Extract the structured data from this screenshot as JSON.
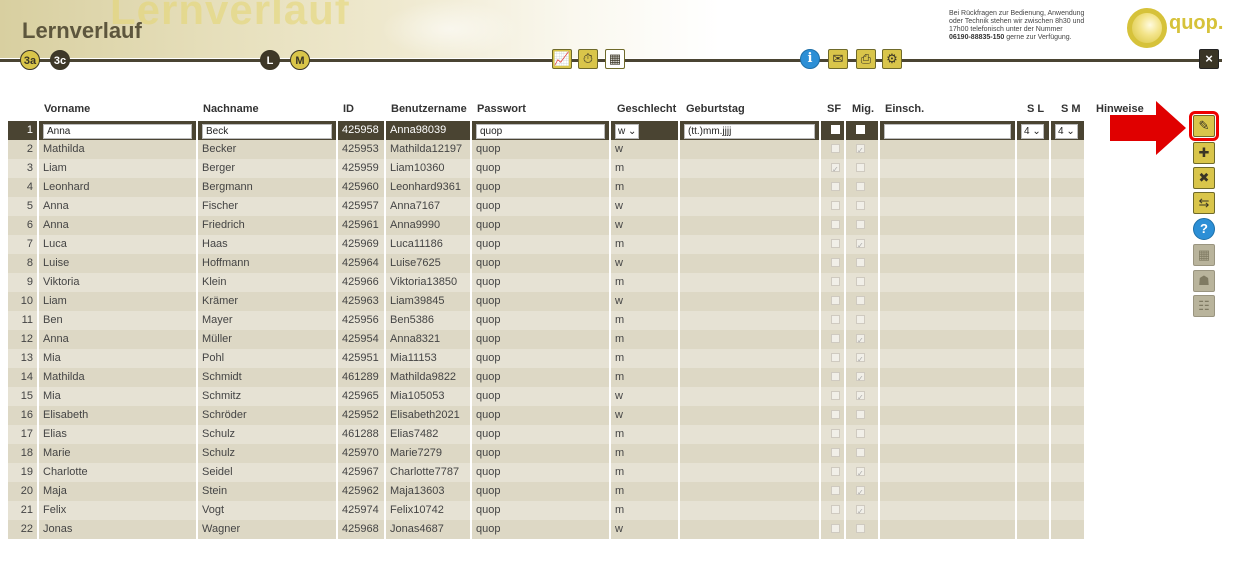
{
  "header": {
    "title": "Lernverlauf",
    "watermark": "Lernverlauf",
    "class_tabs": [
      "3a",
      "3c"
    ],
    "mode_tabs": [
      "L",
      "M"
    ],
    "support_text_1": "Bei Rückfragen zur Bedienung, Anwendung",
    "support_text_2": "oder Technik stehen wir zwischen 8h30 und",
    "support_text_3": "17h00 telefonisch unter der Nummer",
    "support_phone": "06190-88835-150",
    "support_text_4": "gerne zur Verfügung.",
    "logo_text": "quop."
  },
  "icons": {
    "chart": "chart-icon",
    "clock": "time-settings-icon",
    "calendar": "calendar-icon",
    "info": "info-icon",
    "mail": "mail-icon",
    "print": "print-icon",
    "settings": "settings-icon",
    "close": "close-icon"
  },
  "columns": {
    "vorname": "Vorname",
    "nachname": "Nachname",
    "id": "ID",
    "benutzername": "Benutzername",
    "passwort": "Passwort",
    "geschlecht": "Geschlecht",
    "geburtstag": "Geburtstag",
    "sf": "SF",
    "mig": "Mig.",
    "einsch": "Einsch.",
    "sl": "S L",
    "sm": "S M",
    "hinweise": "Hinweise"
  },
  "edit_row": {
    "vorname": "Anna",
    "nachname": "Beck",
    "id": "425958",
    "benutzername": "Anna98039",
    "passwort": "quop",
    "geschlecht": "w",
    "geburtstag": "(tt.)mm.jjjj",
    "sl": "4",
    "sm": "4"
  },
  "rows": [
    {
      "n": "1",
      "vorname": "Anna",
      "nachname": "Beck",
      "id": "425958",
      "user": "Anna98039",
      "pw": "quop",
      "g": "w",
      "sf": false,
      "mig": false
    },
    {
      "n": "2",
      "vorname": "Mathilda",
      "nachname": "Becker",
      "id": "425953",
      "user": "Mathilda12197",
      "pw": "quop",
      "g": "w",
      "sf": false,
      "mig": true
    },
    {
      "n": "3",
      "vorname": "Liam",
      "nachname": "Berger",
      "id": "425959",
      "user": "Liam10360",
      "pw": "quop",
      "g": "m",
      "sf": true,
      "mig": false
    },
    {
      "n": "4",
      "vorname": "Leonhard",
      "nachname": "Bergmann",
      "id": "425960",
      "user": "Leonhard9361",
      "pw": "quop",
      "g": "m",
      "sf": false,
      "mig": false
    },
    {
      "n": "5",
      "vorname": "Anna",
      "nachname": "Fischer",
      "id": "425957",
      "user": "Anna7167",
      "pw": "quop",
      "g": "w",
      "sf": false,
      "mig": false
    },
    {
      "n": "6",
      "vorname": "Anna",
      "nachname": "Friedrich",
      "id": "425961",
      "user": "Anna9990",
      "pw": "quop",
      "g": "w",
      "sf": false,
      "mig": false
    },
    {
      "n": "7",
      "vorname": "Luca",
      "nachname": "Haas",
      "id": "425969",
      "user": "Luca11186",
      "pw": "quop",
      "g": "m",
      "sf": false,
      "mig": true
    },
    {
      "n": "8",
      "vorname": "Luise",
      "nachname": "Hoffmann",
      "id": "425964",
      "user": "Luise7625",
      "pw": "quop",
      "g": "w",
      "sf": false,
      "mig": false
    },
    {
      "n": "9",
      "vorname": "Viktoria",
      "nachname": "Klein",
      "id": "425966",
      "user": "Viktoria13850",
      "pw": "quop",
      "g": "m",
      "sf": false,
      "mig": false
    },
    {
      "n": "10",
      "vorname": "Liam",
      "nachname": "Krämer",
      "id": "425963",
      "user": "Liam39845",
      "pw": "quop",
      "g": "w",
      "sf": false,
      "mig": false
    },
    {
      "n": "11",
      "vorname": "Ben",
      "nachname": "Mayer",
      "id": "425956",
      "user": "Ben5386",
      "pw": "quop",
      "g": "m",
      "sf": false,
      "mig": false
    },
    {
      "n": "12",
      "vorname": "Anna",
      "nachname": "Müller",
      "id": "425954",
      "user": "Anna8321",
      "pw": "quop",
      "g": "m",
      "sf": false,
      "mig": true
    },
    {
      "n": "13",
      "vorname": "Mia",
      "nachname": "Pohl",
      "id": "425951",
      "user": "Mia11153",
      "pw": "quop",
      "g": "m",
      "sf": false,
      "mig": true
    },
    {
      "n": "14",
      "vorname": "Mathilda",
      "nachname": "Schmidt",
      "id": "461289",
      "user": "Mathilda9822",
      "pw": "quop",
      "g": "m",
      "sf": false,
      "mig": true
    },
    {
      "n": "15",
      "vorname": "Mia",
      "nachname": "Schmitz",
      "id": "425965",
      "user": "Mia105053",
      "pw": "quop",
      "g": "w",
      "sf": false,
      "mig": true
    },
    {
      "n": "16",
      "vorname": "Elisabeth",
      "nachname": "Schröder",
      "id": "425952",
      "user": "Elisabeth2021",
      "pw": "quop",
      "g": "w",
      "sf": false,
      "mig": false
    },
    {
      "n": "17",
      "vorname": "Elias",
      "nachname": "Schulz",
      "id": "461288",
      "user": "Elias7482",
      "pw": "quop",
      "g": "m",
      "sf": false,
      "mig": false
    },
    {
      "n": "18",
      "vorname": "Marie",
      "nachname": "Schulz",
      "id": "425970",
      "user": "Marie7279",
      "pw": "quop",
      "g": "m",
      "sf": false,
      "mig": false
    },
    {
      "n": "19",
      "vorname": "Charlotte",
      "nachname": "Seidel",
      "id": "425967",
      "user": "Charlotte7787",
      "pw": "quop",
      "g": "m",
      "sf": false,
      "mig": true
    },
    {
      "n": "20",
      "vorname": "Maja",
      "nachname": "Stein",
      "id": "425962",
      "user": "Maja13603",
      "pw": "quop",
      "g": "m",
      "sf": false,
      "mig": true
    },
    {
      "n": "21",
      "vorname": "Felix",
      "nachname": "Vogt",
      "id": "425974",
      "user": "Felix10742",
      "pw": "quop",
      "g": "m",
      "sf": false,
      "mig": true
    },
    {
      "n": "22",
      "vorname": "Jonas",
      "nachname": "Wagner",
      "id": "425968",
      "user": "Jonas4687",
      "pw": "quop",
      "g": "w",
      "sf": false,
      "mig": false
    }
  ],
  "side_toolbar": [
    {
      "name": "edit-student-icon",
      "glyph": "✎",
      "state": "highlighted"
    },
    {
      "name": "add-student-icon",
      "glyph": "✚",
      "state": "active"
    },
    {
      "name": "remove-student-icon",
      "glyph": "✖",
      "state": "active"
    },
    {
      "name": "move-student-icon",
      "glyph": "⇆",
      "state": "active"
    },
    {
      "name": "help-icon",
      "glyph": "?",
      "state": "help"
    },
    {
      "name": "qr-code-icon",
      "glyph": "▦",
      "state": "disabled"
    },
    {
      "name": "group-icon",
      "glyph": "☗",
      "state": "disabled"
    },
    {
      "name": "group-settings-icon",
      "glyph": "☷",
      "state": "disabled"
    }
  ],
  "colors": {
    "accent_gold": "#d9c54a",
    "dark_olive": "#4a4432",
    "row_fill": "#ddd8c5",
    "highlight_red": "#e00000"
  }
}
